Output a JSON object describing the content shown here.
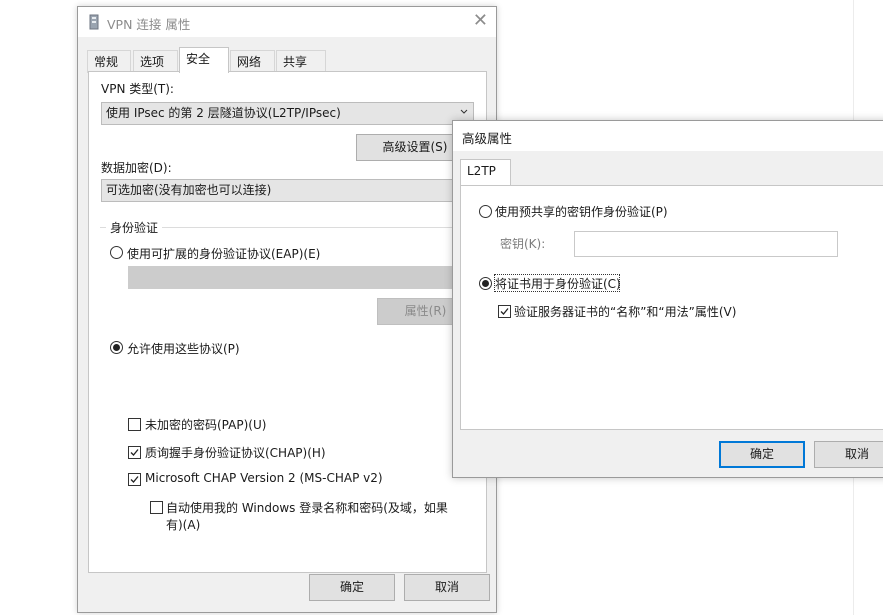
{
  "main_dialog": {
    "title": "VPN 连接 属性",
    "tabs": [
      "常规",
      "选项",
      "安全",
      "网络",
      "共享"
    ],
    "vpn_type_label": "VPN 类型(T):",
    "vpn_type_value": "使用 IPsec 的第 2 层隧道协议(L2TP/IPsec)",
    "advanced_button": "高级设置(S)",
    "encryption_label": "数据加密(D):",
    "encryption_value": "可选加密(没有加密也可以连接)",
    "auth_group_label": "身份验证",
    "eap_radio_label": "使用可扩展的身份验证协议(EAP)(E)",
    "eap_combo_value": "",
    "properties_button": "属性(R)",
    "allow_protocols_radio_label": "允许使用这些协议(P)",
    "pap_label": "未加密的密码(PAP)(U)",
    "chap_label": "质询握手身份验证协议(CHAP)(H)",
    "mschap_label": "Microsoft CHAP Version 2 (MS-CHAP v2)",
    "auto_windows_label_line1": "自动使用我的 Windows 登录名称和密码(及域，如果",
    "auto_windows_label_line2": "有)(A)",
    "ok_button": "确定",
    "cancel_button": "取消",
    "pap_checked": false,
    "chap_checked": true,
    "mschap_checked": true,
    "auto_windows_checked": false
  },
  "advanced_dialog": {
    "title": "高级属性",
    "tab": "L2TP",
    "preshared_radio_label": "使用预共享的密钥作身份验证(P)",
    "key_label": "密钥(K):",
    "key_value": "",
    "cert_radio_label": "将证书用于身份验证(C)",
    "verify_label": "验证服务器证书的“名称”和“用法”属性(V)",
    "ok_button": "确定",
    "cancel_button": "取消",
    "verify_checked": true
  },
  "colors": {
    "window_bg": "#f0f0f0",
    "focus_border": "#0078d7",
    "disabled_text": "#8a8a8a"
  }
}
